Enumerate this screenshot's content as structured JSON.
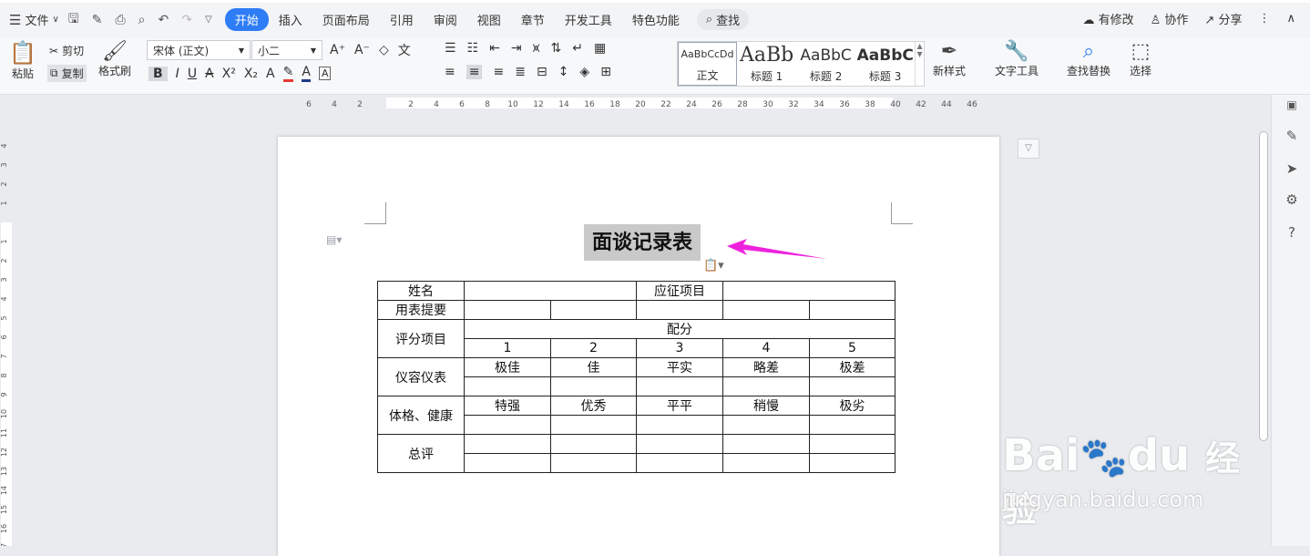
{
  "menubar": {
    "file_label": "文件",
    "tabs": [
      "开始",
      "插入",
      "页面布局",
      "引用",
      "审阅",
      "视图",
      "章节",
      "开发工具",
      "特色功能"
    ],
    "active_tab": "开始",
    "search_label": "查找",
    "right": {
      "modified": "有修改",
      "collab": "协作",
      "share": "分享"
    }
  },
  "ribbon": {
    "paste": "粘贴",
    "cut": "剪切",
    "copy": "复制",
    "format_painter": "格式刷",
    "font_name": "宋体 (正文)",
    "font_size": "小二",
    "styles": [
      {
        "preview": "AaBbCcDd",
        "label": "正文"
      },
      {
        "preview": "AaBb",
        "label": "标题 1"
      },
      {
        "preview": "AaBbC",
        "label": "标题 2"
      },
      {
        "preview": "AaBbC",
        "label": "标题 3"
      }
    ],
    "new_style": "新样式",
    "text_tools": "文字工具",
    "find_replace": "查找替换",
    "select": "选择"
  },
  "ruler": {
    "h_ticks": [
      "6",
      "4",
      "2",
      "",
      "2",
      "4",
      "6",
      "8",
      "10",
      "12",
      "14",
      "16",
      "18",
      "20",
      "22",
      "24",
      "26",
      "28",
      "30",
      "32",
      "34",
      "36",
      "38",
      "40",
      "42",
      "44",
      "46"
    ],
    "v_ticks": [
      "4",
      "3",
      "2",
      "1",
      "",
      "1",
      "2",
      "3",
      "4",
      "5",
      "6",
      "7",
      "8",
      "9",
      "10",
      "11",
      "12",
      "13",
      "14",
      "15",
      "16",
      "17"
    ]
  },
  "document": {
    "title": "面谈记录表",
    "table": {
      "name_label": "姓名",
      "position_label": "应征项目",
      "hint_label": "用表提要",
      "score_item_label": "评分项目",
      "score_label": "配分",
      "scores": [
        "1",
        "2",
        "3",
        "4",
        "5"
      ],
      "appearance_label": "仪容仪表",
      "appearance_levels": [
        "极佳",
        "佳",
        "平实",
        "略差",
        "极差"
      ],
      "health_label": "体格、健康",
      "health_levels": [
        "特强",
        "优秀",
        "平平",
        "稍慢",
        "极劣"
      ],
      "overall_label": "总评"
    }
  },
  "watermark": {
    "brand": "Bai",
    "brand2": "du",
    "cn": "经验",
    "url": "jingyan.baidu.com"
  },
  "colors": {
    "accent": "#2e7cf6",
    "arrow": "#ee22dd",
    "highlight": "#c9c9c9"
  }
}
